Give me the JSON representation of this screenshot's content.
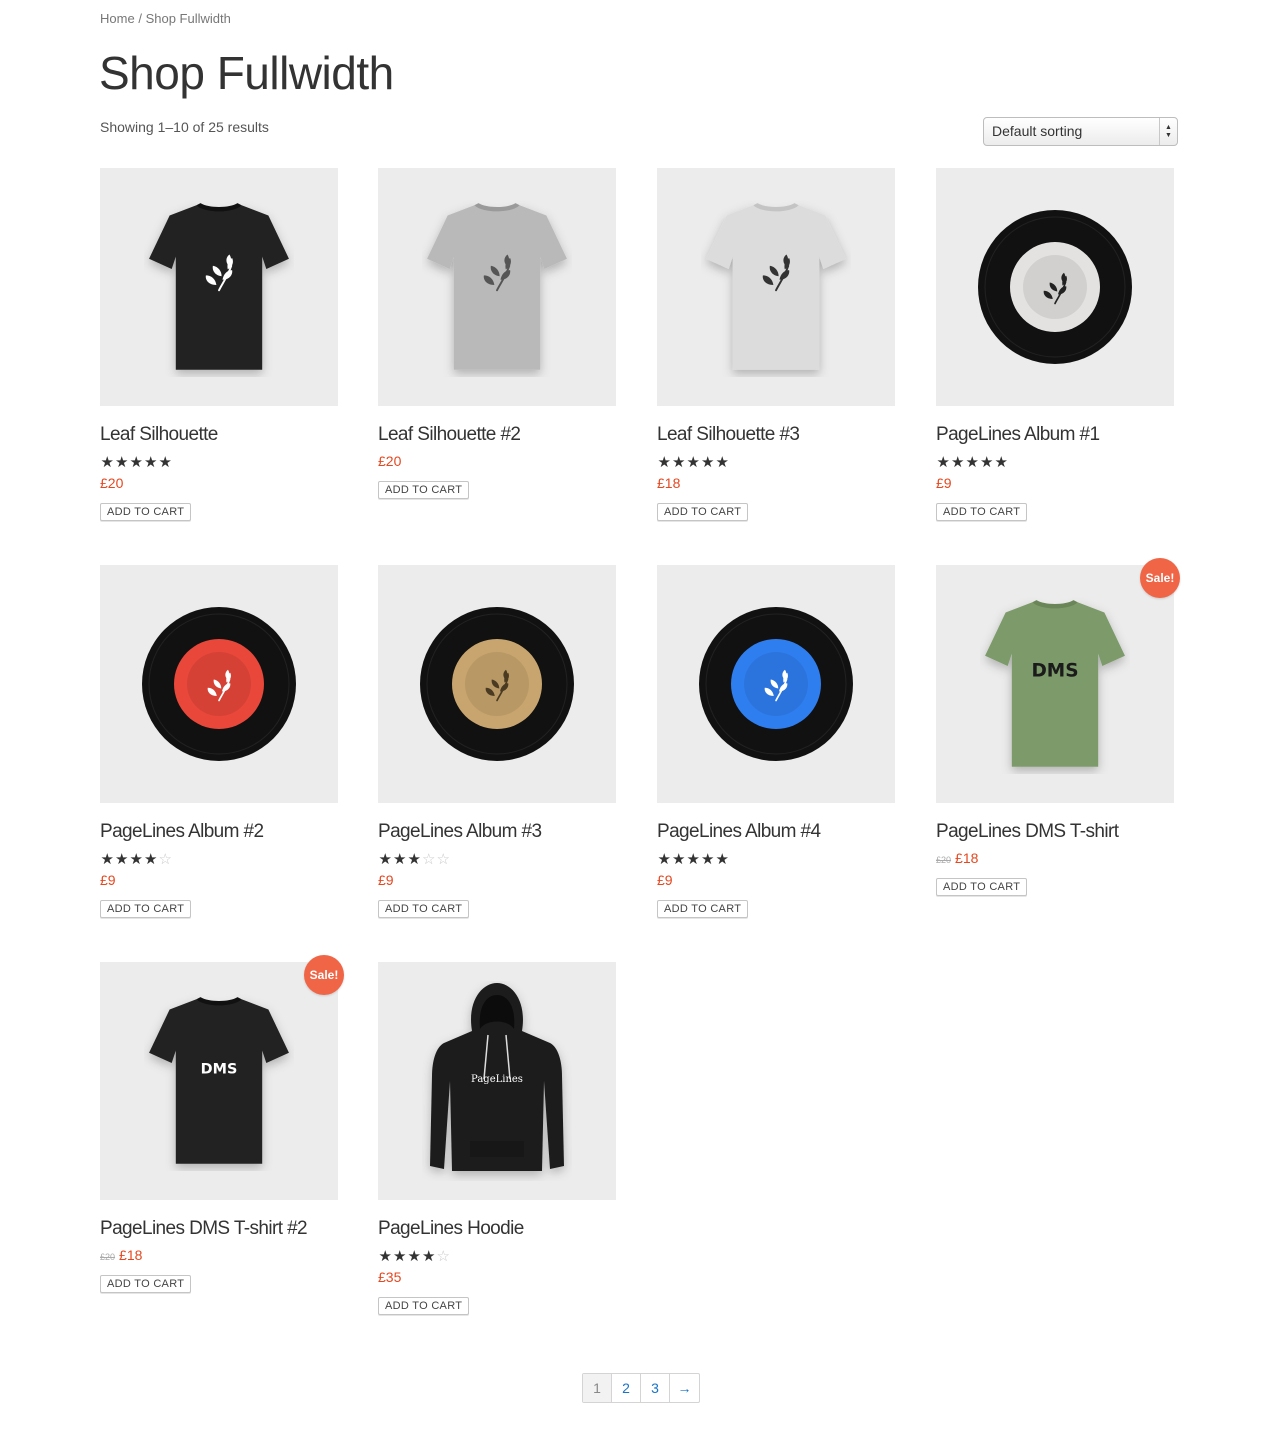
{
  "breadcrumb": {
    "home": "Home",
    "separator": "/",
    "current": "Shop Fullwidth"
  },
  "page_title": "Shop Fullwidth",
  "result_count": "Showing 1–10 of 25 results",
  "sorting": {
    "selected": "Default sorting"
  },
  "products": [
    {
      "title": "Leaf Silhouette",
      "rating": 5,
      "old_price": "",
      "price": "£20",
      "button": "ADD TO CART",
      "sale": "",
      "image": "tshirt-black-leaf"
    },
    {
      "title": "Leaf Silhouette #2",
      "rating": 0,
      "old_price": "",
      "price": "£20",
      "button": "ADD TO CART",
      "sale": "",
      "image": "tshirt-grey-leaf"
    },
    {
      "title": "Leaf Silhouette #3",
      "rating": 5,
      "old_price": "",
      "price": "£18",
      "button": "ADD TO CART",
      "sale": "",
      "image": "tshirt-white-leaf"
    },
    {
      "title": "PageLines Album #1",
      "rating": 5,
      "old_price": "",
      "price": "£9",
      "button": "ADD TO CART",
      "sale": "",
      "image": "vinyl-white"
    },
    {
      "title": "PageLines Album #2",
      "rating": 4,
      "old_price": "",
      "price": "£9",
      "button": "ADD TO CART",
      "sale": "",
      "image": "vinyl-red"
    },
    {
      "title": "PageLines Album #3",
      "rating": 3,
      "old_price": "",
      "price": "£9",
      "button": "ADD TO CART",
      "sale": "",
      "image": "vinyl-gold"
    },
    {
      "title": "PageLines Album #4",
      "rating": 5,
      "old_price": "",
      "price": "£9",
      "button": "ADD TO CART",
      "sale": "",
      "image": "vinyl-blue"
    },
    {
      "title": "PageLines DMS T-shirt",
      "rating": 0,
      "old_price": "£20",
      "price": "£18",
      "button": "ADD TO CART",
      "sale": "Sale!",
      "image": "tshirt-green-dms",
      "print": "DMS"
    },
    {
      "title": "PageLines DMS T-shirt #2",
      "rating": 0,
      "old_price": "£20",
      "price": "£18",
      "button": "ADD TO CART",
      "sale": "Sale!",
      "image": "tshirt-black-dms",
      "print": "DMS"
    },
    {
      "title": "PageLines Hoodie",
      "rating": 4.5,
      "old_price": "",
      "price": "£35",
      "button": "ADD TO CART",
      "sale": "",
      "image": "hoodie-black",
      "print": "PageLines"
    }
  ],
  "pagination": {
    "pages": [
      "1",
      "2",
      "3"
    ],
    "current": "1",
    "next": "→"
  },
  "colors": {
    "price": "#e5471f",
    "sale_badge": "#ef6546",
    "link": "#1a73c7",
    "thumb_bg": "#ececec"
  }
}
